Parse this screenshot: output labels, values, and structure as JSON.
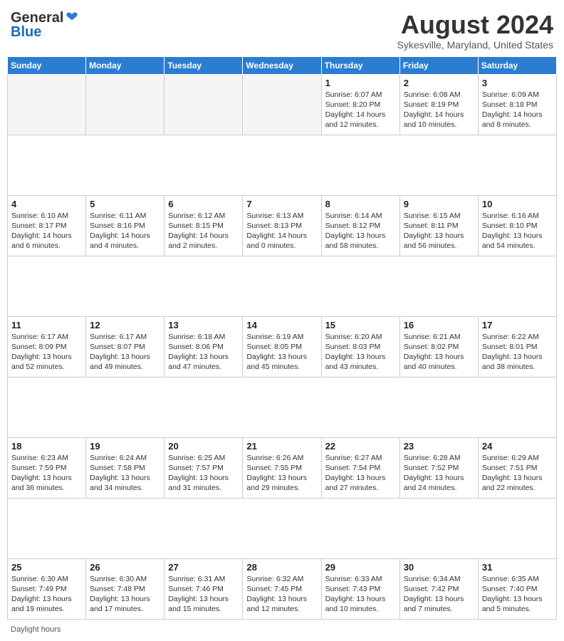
{
  "header": {
    "logo_general": "General",
    "logo_blue": "Blue",
    "month_title": "August 2024",
    "subtitle": "Sykesville, Maryland, United States"
  },
  "weekdays": [
    "Sunday",
    "Monday",
    "Tuesday",
    "Wednesday",
    "Thursday",
    "Friday",
    "Saturday"
  ],
  "footer": {
    "daylight_label": "Daylight hours"
  },
  "weeks": [
    [
      {
        "day": "",
        "info": ""
      },
      {
        "day": "",
        "info": ""
      },
      {
        "day": "",
        "info": ""
      },
      {
        "day": "",
        "info": ""
      },
      {
        "day": "1",
        "info": "Sunrise: 6:07 AM\nSunset: 8:20 PM\nDaylight: 14 hours\nand 12 minutes."
      },
      {
        "day": "2",
        "info": "Sunrise: 6:08 AM\nSunset: 8:19 PM\nDaylight: 14 hours\nand 10 minutes."
      },
      {
        "day": "3",
        "info": "Sunrise: 6:09 AM\nSunset: 8:18 PM\nDaylight: 14 hours\nand 8 minutes."
      }
    ],
    [
      {
        "day": "4",
        "info": "Sunrise: 6:10 AM\nSunset: 8:17 PM\nDaylight: 14 hours\nand 6 minutes."
      },
      {
        "day": "5",
        "info": "Sunrise: 6:11 AM\nSunset: 8:16 PM\nDaylight: 14 hours\nand 4 minutes."
      },
      {
        "day": "6",
        "info": "Sunrise: 6:12 AM\nSunset: 8:15 PM\nDaylight: 14 hours\nand 2 minutes."
      },
      {
        "day": "7",
        "info": "Sunrise: 6:13 AM\nSunset: 8:13 PM\nDaylight: 14 hours\nand 0 minutes."
      },
      {
        "day": "8",
        "info": "Sunrise: 6:14 AM\nSunset: 8:12 PM\nDaylight: 13 hours\nand 58 minutes."
      },
      {
        "day": "9",
        "info": "Sunrise: 6:15 AM\nSunset: 8:11 PM\nDaylight: 13 hours\nand 56 minutes."
      },
      {
        "day": "10",
        "info": "Sunrise: 6:16 AM\nSunset: 8:10 PM\nDaylight: 13 hours\nand 54 minutes."
      }
    ],
    [
      {
        "day": "11",
        "info": "Sunrise: 6:17 AM\nSunset: 8:09 PM\nDaylight: 13 hours\nand 52 minutes."
      },
      {
        "day": "12",
        "info": "Sunrise: 6:17 AM\nSunset: 8:07 PM\nDaylight: 13 hours\nand 49 minutes."
      },
      {
        "day": "13",
        "info": "Sunrise: 6:18 AM\nSunset: 8:06 PM\nDaylight: 13 hours\nand 47 minutes."
      },
      {
        "day": "14",
        "info": "Sunrise: 6:19 AM\nSunset: 8:05 PM\nDaylight: 13 hours\nand 45 minutes."
      },
      {
        "day": "15",
        "info": "Sunrise: 6:20 AM\nSunset: 8:03 PM\nDaylight: 13 hours\nand 43 minutes."
      },
      {
        "day": "16",
        "info": "Sunrise: 6:21 AM\nSunset: 8:02 PM\nDaylight: 13 hours\nand 40 minutes."
      },
      {
        "day": "17",
        "info": "Sunrise: 6:22 AM\nSunset: 8:01 PM\nDaylight: 13 hours\nand 38 minutes."
      }
    ],
    [
      {
        "day": "18",
        "info": "Sunrise: 6:23 AM\nSunset: 7:59 PM\nDaylight: 13 hours\nand 36 minutes."
      },
      {
        "day": "19",
        "info": "Sunrise: 6:24 AM\nSunset: 7:58 PM\nDaylight: 13 hours\nand 34 minutes."
      },
      {
        "day": "20",
        "info": "Sunrise: 6:25 AM\nSunset: 7:57 PM\nDaylight: 13 hours\nand 31 minutes."
      },
      {
        "day": "21",
        "info": "Sunrise: 6:26 AM\nSunset: 7:55 PM\nDaylight: 13 hours\nand 29 minutes."
      },
      {
        "day": "22",
        "info": "Sunrise: 6:27 AM\nSunset: 7:54 PM\nDaylight: 13 hours\nand 27 minutes."
      },
      {
        "day": "23",
        "info": "Sunrise: 6:28 AM\nSunset: 7:52 PM\nDaylight: 13 hours\nand 24 minutes."
      },
      {
        "day": "24",
        "info": "Sunrise: 6:29 AM\nSunset: 7:51 PM\nDaylight: 13 hours\nand 22 minutes."
      }
    ],
    [
      {
        "day": "25",
        "info": "Sunrise: 6:30 AM\nSunset: 7:49 PM\nDaylight: 13 hours\nand 19 minutes."
      },
      {
        "day": "26",
        "info": "Sunrise: 6:30 AM\nSunset: 7:48 PM\nDaylight: 13 hours\nand 17 minutes."
      },
      {
        "day": "27",
        "info": "Sunrise: 6:31 AM\nSunset: 7:46 PM\nDaylight: 13 hours\nand 15 minutes."
      },
      {
        "day": "28",
        "info": "Sunrise: 6:32 AM\nSunset: 7:45 PM\nDaylight: 13 hours\nand 12 minutes."
      },
      {
        "day": "29",
        "info": "Sunrise: 6:33 AM\nSunset: 7:43 PM\nDaylight: 13 hours\nand 10 minutes."
      },
      {
        "day": "30",
        "info": "Sunrise: 6:34 AM\nSunset: 7:42 PM\nDaylight: 13 hours\nand 7 minutes."
      },
      {
        "day": "31",
        "info": "Sunrise: 6:35 AM\nSunset: 7:40 PM\nDaylight: 13 hours\nand 5 minutes."
      }
    ]
  ]
}
